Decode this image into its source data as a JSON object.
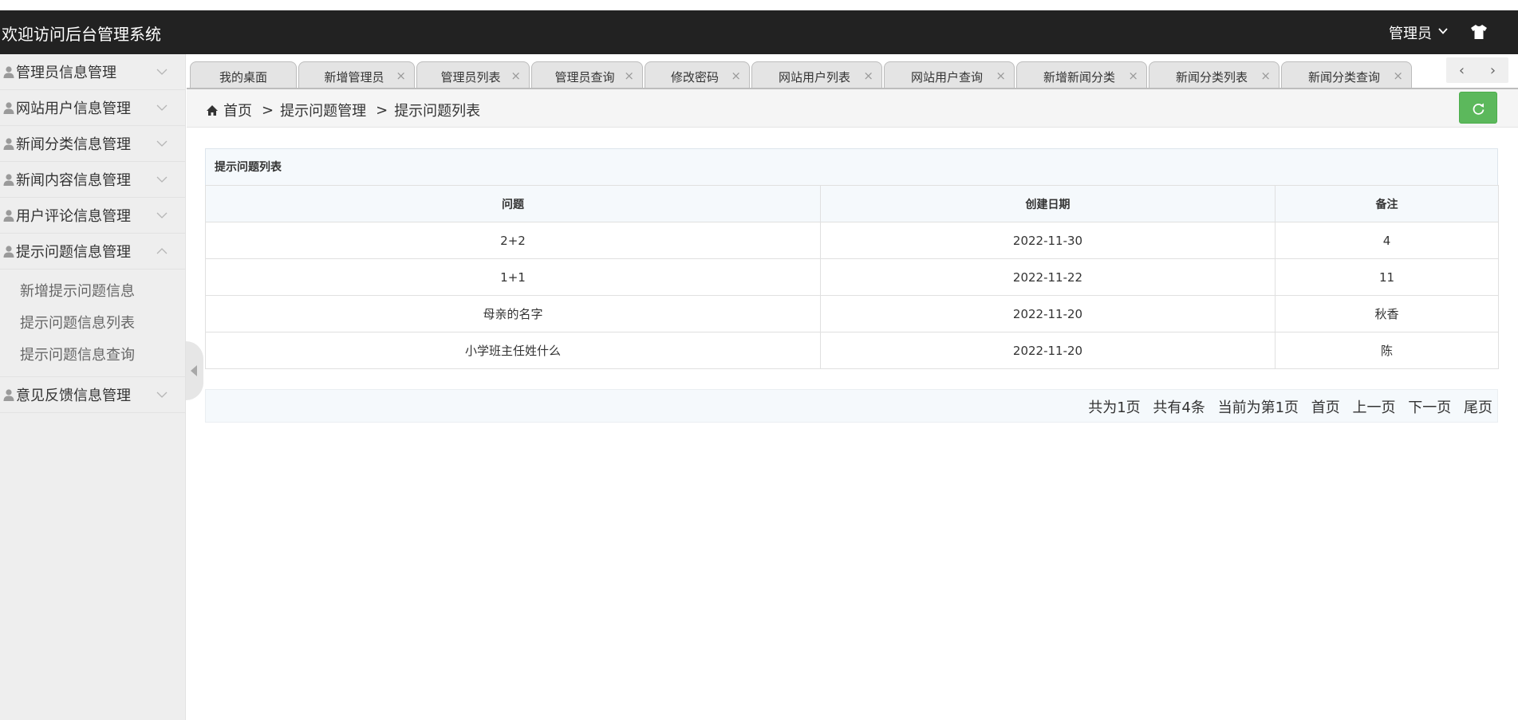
{
  "header": {
    "title": "欢迎访问后台管理系统",
    "user_label": "管理员"
  },
  "sidebar": {
    "items": [
      {
        "label": "管理员信息管理",
        "expanded": false
      },
      {
        "label": "网站用户信息管理",
        "expanded": false
      },
      {
        "label": "新闻分类信息管理",
        "expanded": false
      },
      {
        "label": "新闻内容信息管理",
        "expanded": false
      },
      {
        "label": "用户评论信息管理",
        "expanded": false
      },
      {
        "label": "提示问题信息管理",
        "expanded": true
      },
      {
        "label": "意见反馈信息管理",
        "expanded": false
      }
    ],
    "sub_items": [
      {
        "label": "新增提示问题信息"
      },
      {
        "label": "提示问题信息列表"
      },
      {
        "label": "提示问题信息查询"
      }
    ]
  },
  "tabs": [
    {
      "label": "我的桌面",
      "close": ""
    },
    {
      "label": "新增管理员",
      "close": "×"
    },
    {
      "label": "管理员列表",
      "close": "×"
    },
    {
      "label": "管理员查询",
      "close": "×"
    },
    {
      "label": "修改密码",
      "close": "×"
    },
    {
      "label": "网站用户列表",
      "close": "×"
    },
    {
      "label": "网站用户查询",
      "close": "×"
    },
    {
      "label": "新增新闻分类",
      "close": "×"
    },
    {
      "label": "新闻分类列表",
      "close": "×"
    },
    {
      "label": "新闻分类查询",
      "close": "×"
    }
  ],
  "tab_scroll": {
    "prev": "‹",
    "next": "›"
  },
  "breadcrumb": {
    "home": "首页",
    "sep": ">",
    "level1": "提示问题管理",
    "level2": "提示问题列表"
  },
  "table": {
    "title": "提示问题列表",
    "columns": [
      "问题",
      "创建日期",
      "备注"
    ],
    "rows": [
      [
        "2+2",
        "2022-11-30",
        "4"
      ],
      [
        "1+1",
        "2022-11-22",
        "11"
      ],
      [
        "母亲的名字",
        "2022-11-20",
        "秋香"
      ],
      [
        "小学班主任姓什么",
        "2022-11-20",
        "陈"
      ]
    ]
  },
  "pager": {
    "total_pages": "共为1页",
    "total_items": "共有4条",
    "current": "当前为第1页",
    "first": "首页",
    "prev": "上一页",
    "next": "下一页",
    "last": "尾页"
  },
  "colors": {
    "header_bg": "#222222",
    "sidebar_bg": "#eeeeee",
    "refresh_green": "#5cb85c",
    "table_head_bg": "#f5f9fc"
  },
  "icons": {
    "user_nav": "user-icon",
    "chevron": "chevron-down-icon",
    "home": "home-icon",
    "refresh": "refresh-icon",
    "theme": "tshirt-icon"
  }
}
